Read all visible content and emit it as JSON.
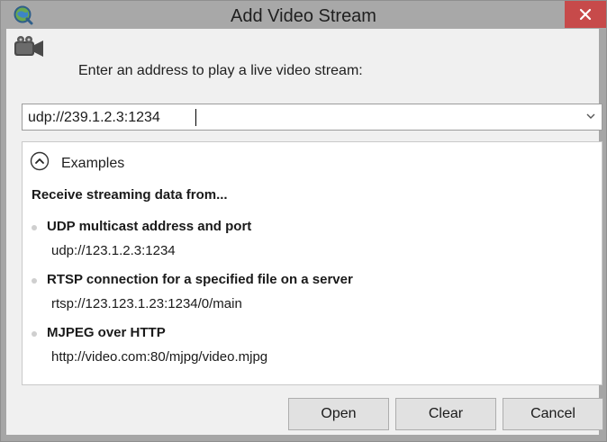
{
  "window": {
    "title": "Add Video Stream",
    "app_icon": "qgis-globe-icon",
    "close_icon": "close-icon"
  },
  "prompt": {
    "icon": "video-camera-icon",
    "text": "Enter an address to play a live video stream:"
  },
  "address": {
    "value": "udp://239.1.2.3:1234",
    "dropdown_icon": "chevron-down-icon"
  },
  "examples": {
    "toggle_icon": "chevron-up-circle-icon",
    "label": "Examples",
    "heading": "Receive streaming data from...",
    "items": [
      {
        "title": "UDP multicast address and port",
        "url": "udp://123.1.2.3:1234"
      },
      {
        "title": "RTSP connection for a specified file on a server",
        "url": "rtsp://123.123.1.23:1234/0/main"
      },
      {
        "title": "MJPEG over HTTP",
        "url": "http://video.com:80/mjpg/video.mjpg"
      }
    ]
  },
  "buttons": {
    "open": "Open",
    "clear": "Clear",
    "cancel": "Cancel"
  },
  "colors": {
    "titlebar": "#a8a8a8",
    "close_button": "#c74a4a",
    "client_background": "#f0f0f0",
    "button_face": "#e1e1e1"
  }
}
